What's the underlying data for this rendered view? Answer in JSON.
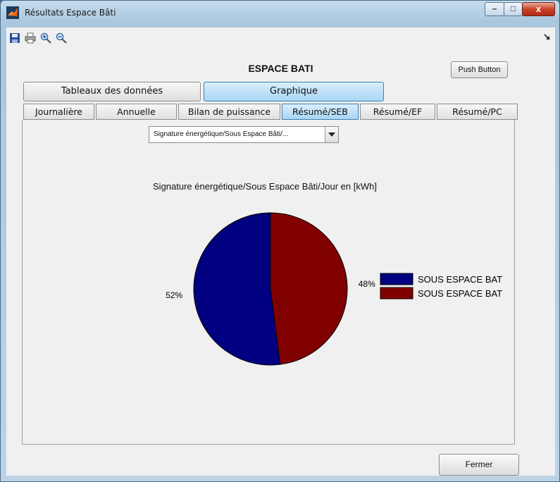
{
  "window": {
    "title": "Résultats Espace Bâti",
    "close_glyph": "x"
  },
  "toolbar": {
    "icons": [
      "save-icon",
      "print-icon",
      "zoom-in-icon",
      "zoom-out-icon"
    ]
  },
  "header": {
    "title": "ESPACE BATI",
    "push_button": "Push Button"
  },
  "main_tabs": [
    {
      "label": "Tableaux des données",
      "active": false
    },
    {
      "label": "Graphique",
      "active": true
    }
  ],
  "sub_tabs": [
    {
      "label": "Journalière",
      "active": false
    },
    {
      "label": "Annuelle",
      "active": false
    },
    {
      "label": "Bilan de puissance",
      "active": false
    },
    {
      "label": "Résumé/SEB",
      "active": true
    },
    {
      "label": "Résumé/EF",
      "active": false
    },
    {
      "label": "Résumé/PC",
      "active": false
    }
  ],
  "dropdown": {
    "selected": "Signature énergétique/Sous Espace Bâti/..."
  },
  "chart_data": {
    "type": "pie",
    "title": "Signature énergétique/Sous Espace Bâti/Jour en [kWh]",
    "slices": [
      {
        "label": "SOUS ESPACE BAT",
        "percent": 52,
        "percent_label": "52%",
        "color": "#000080"
      },
      {
        "label": "SOUS ESPACE BAT",
        "percent": 48,
        "percent_label": "48%",
        "color": "#800000"
      }
    ],
    "legend_position": "right"
  },
  "footer": {
    "close_button": "Fermer"
  }
}
